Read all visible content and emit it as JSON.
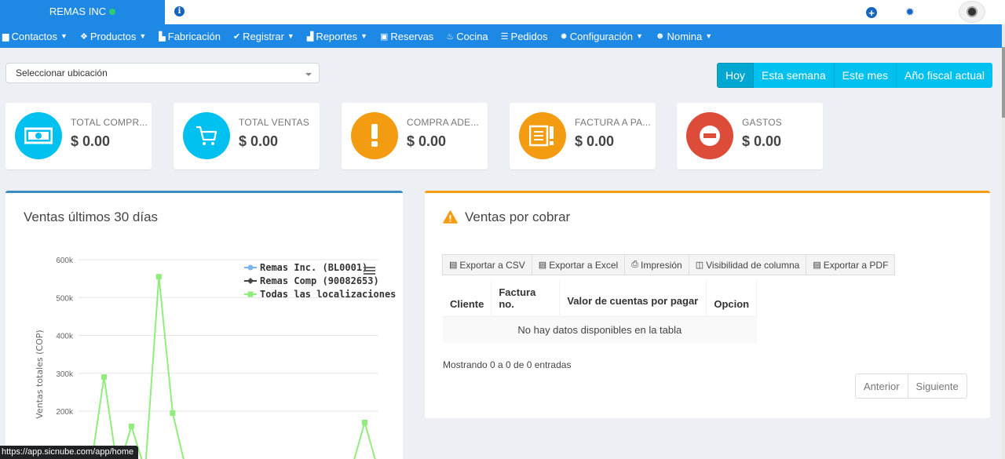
{
  "header": {
    "brand": "REMAS INC",
    "info_icon": "info-circle-icon",
    "plus_icon": "plus-circle-icon",
    "gear_icon": "gear-icon",
    "avatar_icon": "user-avatar-icon"
  },
  "nav": {
    "items": [
      {
        "label": "Contactos",
        "icon": "address-book-icon",
        "caret": true
      },
      {
        "label": "Productos",
        "icon": "cubes-icon",
        "caret": true
      },
      {
        "label": "Fabricación",
        "icon": "industry-icon",
        "caret": false
      },
      {
        "label": "Registrar",
        "icon": "check-circle-icon",
        "caret": true
      },
      {
        "label": "Reportes",
        "icon": "chart-icon",
        "caret": true
      },
      {
        "label": "Reservas",
        "icon": "calendar-check-icon",
        "caret": false
      },
      {
        "label": "Cocina",
        "icon": "fire-icon",
        "caret": false
      },
      {
        "label": "Pedidos",
        "icon": "list-alt-icon",
        "caret": false
      },
      {
        "label": "Configuración",
        "icon": "cog-icon",
        "caret": true
      },
      {
        "label": "Nomina",
        "icon": "users-icon",
        "caret": true
      }
    ]
  },
  "filters": {
    "location_placeholder": "Seleccionar ubicación",
    "date_buttons": [
      "Hoy",
      "Esta semana",
      "Este mes",
      "Año fiscal actual"
    ],
    "active_date": "Hoy"
  },
  "info_boxes": [
    {
      "label": "TOTAL COMPR...",
      "value": "$ 0.00",
      "color": "#00c0ef",
      "icon": "money-icon"
    },
    {
      "label": "TOTAL VENTAS",
      "value": "$ 0.00",
      "color": "#00c0ef",
      "icon": "cart-icon"
    },
    {
      "label": "COMPRA ADE...",
      "value": "$ 0.00",
      "color": "#f39c12",
      "icon": "exclamation-icon"
    },
    {
      "label": "FACTURA A PA...",
      "value": "$ 0.00",
      "color": "#f39c12",
      "icon": "invoice-icon"
    },
    {
      "label": "GASTOS",
      "value": "$ 0.00",
      "color": "#dd4b39",
      "icon": "minus-circle-icon"
    }
  ],
  "sales_panel": {
    "title": "Ventas últimos 30 días"
  },
  "chart_data": {
    "type": "line",
    "title": "",
    "xlabel": "",
    "ylabel": "Ventas totales (COP)",
    "ylim": [
      100000,
      600000
    ],
    "yticks": [
      "600k",
      "500k",
      "400k",
      "300k",
      "200k"
    ],
    "legend_position": "top-right",
    "legend_menu_icon": "hamburger-menu-icon",
    "series": [
      {
        "name": "Remas Inc. (BL0001)",
        "color": "#7cb5ec",
        "marker": "circle",
        "values": []
      },
      {
        "name": "Remas Comp (90082653)",
        "color": "#434348",
        "marker": "diamond",
        "values": []
      },
      {
        "name": "Todas las localizaciones",
        "color": "#90ed7d",
        "marker": "square",
        "values": [
          0,
          290000,
          0,
          160000,
          0,
          555000,
          195000,
          0,
          0,
          0,
          0,
          0,
          0,
          0,
          0,
          0,
          0,
          0,
          0,
          0,
          170000,
          0
        ]
      }
    ]
  },
  "receivables_panel": {
    "title": "Ventas por cobrar",
    "warning_icon": "warning-triangle-icon",
    "export_buttons": [
      {
        "label": "Exportar a CSV",
        "icon": "file-csv-icon"
      },
      {
        "label": "Exportar a Excel",
        "icon": "file-excel-icon"
      },
      {
        "label": "Impresión",
        "icon": "print-icon"
      },
      {
        "label": "Visibilidad de columna",
        "icon": "columns-icon"
      },
      {
        "label": "Exportar a PDF",
        "icon": "file-pdf-icon"
      }
    ],
    "columns": [
      "Cliente",
      "Factura no.",
      "Valor de cuentas por pagar",
      "Opcion"
    ],
    "empty_message": "No hay datos disponibles en la tabla",
    "showing": "Mostrando 0 a 0 de 0 entradas",
    "prev": "Anterior",
    "next": "Siguiente"
  },
  "status_bar": {
    "url": "https://app.sicnube.com/app/home"
  }
}
